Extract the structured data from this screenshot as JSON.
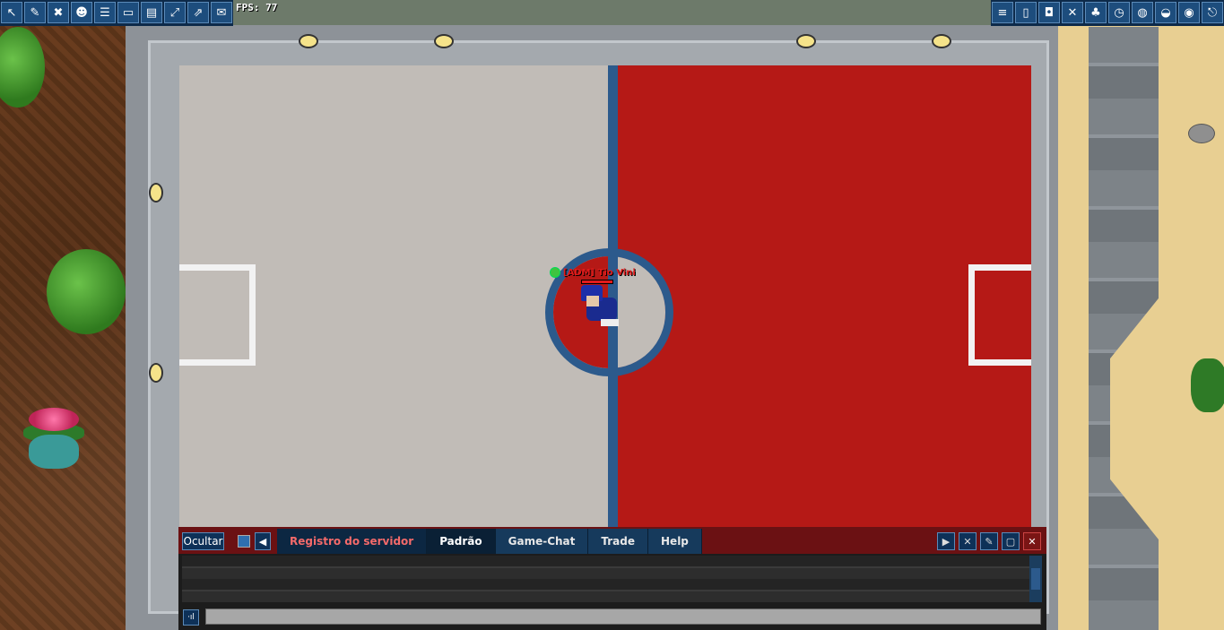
{
  "hud": {
    "fps_label": "FPS: 77",
    "left_icons": [
      "cursor-icon",
      "wand-icon",
      "dex-icon",
      "trainer-icon",
      "list-icon",
      "window-icon",
      "map-icon",
      "fullscreen-icon",
      "external-icon",
      "scroll-icon"
    ],
    "right_icons": [
      "toggle-icon",
      "document-icon",
      "backpack-icon",
      "swords-icon",
      "party-icon",
      "clock-icon",
      "globe-icon",
      "bag-icon",
      "pokeball-icon",
      "exit-icon"
    ]
  },
  "player": {
    "name": "[ADM] Tio Vini"
  },
  "chat": {
    "hide_label": "Ocultar",
    "tabs": [
      {
        "label": "Registro do servidor",
        "active": true
      },
      {
        "label": "Padrão",
        "active": false
      },
      {
        "label": "Game-Chat",
        "active": false
      },
      {
        "label": "Trade",
        "active": false
      },
      {
        "label": "Help",
        "active": false
      }
    ],
    "input_value": ""
  },
  "colors": {
    "court_red": "#b51916",
    "court_gray": "#c1bcb7",
    "line_blue": "#2c5a8c",
    "active_tab_text": "#f46a6a"
  }
}
